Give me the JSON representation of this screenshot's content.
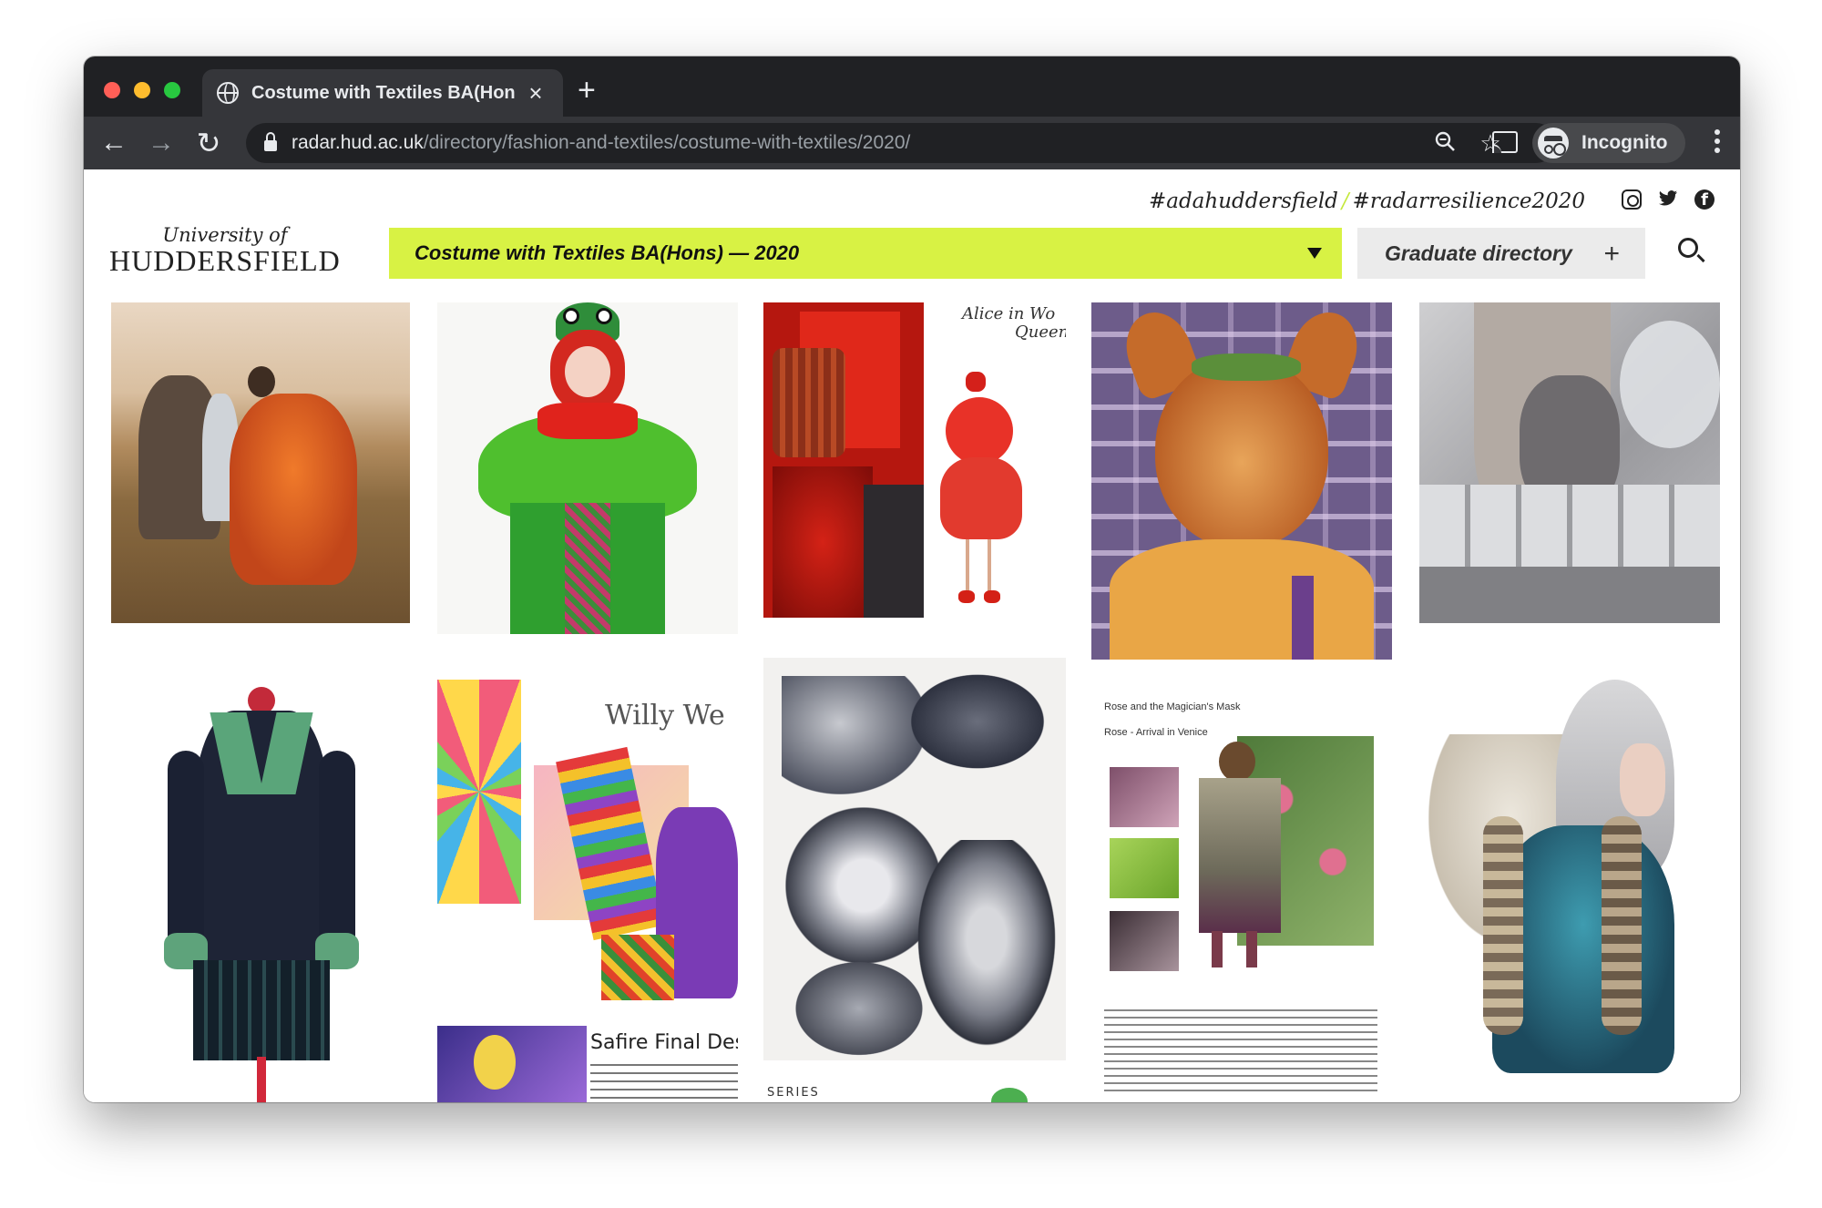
{
  "browser": {
    "tab_title": "Costume with Textiles BA(Hons",
    "url_host": "radar.hud.ac.uk",
    "url_path": "/directory/fashion-and-textiles/costume-with-textiles/2020/",
    "profile_label": "Incognito"
  },
  "site": {
    "hashtag_1": "#adahuddersfield",
    "hashtag_sep": "/",
    "hashtag_2": "#radarresilience2020",
    "logo_top": "University of",
    "logo_main": "HUDDERSFIELD",
    "course_selected": "Costume with Textiles BA(Hons) — 2020",
    "directory_label": "Graduate directory",
    "social_icons": [
      "instagram-icon",
      "twitter-icon",
      "facebook-icon"
    ]
  },
  "gallery": {
    "captions": {
      "alice": "Alice in Wo",
      "queen": "Queen",
      "willy": "Willy We",
      "safire": "Safire Final Desig",
      "rose_title": "Rose and the Magician's Mask",
      "rose_sub": "Rose - Arrival in Venice",
      "series": "SERIES"
    }
  },
  "colors": {
    "accent_lime": "#d8f244",
    "chrome_dark": "#202124",
    "chrome_toolbar": "#35363a"
  }
}
